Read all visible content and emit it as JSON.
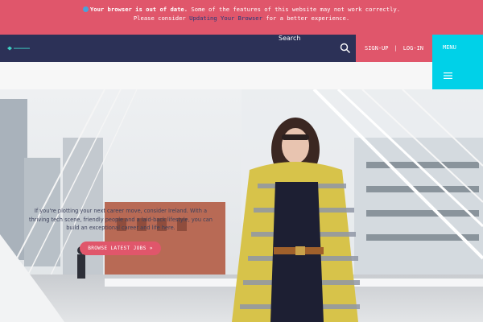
{
  "banner": {
    "bold_text": "Your browser is out of date.",
    "text_line1": "Some of the features of this website may not work correctly.",
    "text_line2_prefix": "Please consider",
    "link_text": "Updating Your Browser",
    "text_line2_suffix": "for a better experience."
  },
  "header": {
    "search_label": "Search",
    "signup_label": "SIGN-UP",
    "separator": "|",
    "login_label": "LOG-IN",
    "menu_label": "MENU"
  },
  "hero": {
    "description": "If you're plotting your next career move, consider Ireland. With a thriving tech scene, friendly people and a laid-back lifestyle, you can build an exceptional career and life here.",
    "cta_label": "BROWSE LATEST JOBS »"
  },
  "colors": {
    "banner_bg": "#e0566b",
    "header_bg": "#2c3157",
    "menu_bg": "#00d1e8",
    "accent": "#e0566b"
  },
  "icons": {
    "warning": "warning-icon",
    "search": "search-icon",
    "menu": "hamburger-icon",
    "logo": "logo"
  }
}
